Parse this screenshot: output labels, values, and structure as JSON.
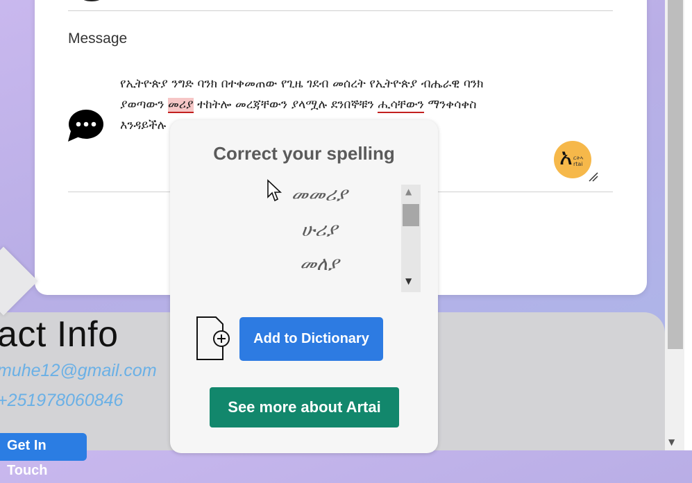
{
  "form": {
    "message_label": "Message",
    "message_lines": [
      {
        "segments": [
          {
            "text": "የኢትዮጵያ ንግድ ባንክ በተቀመጠው የጊዜ ገደብ መሰረት የኢትዮጵያ ብሔራዊ ባንክ",
            "style": "plain"
          }
        ]
      },
      {
        "segments": [
          {
            "text": "ያወጣውን ",
            "style": "plain"
          },
          {
            "text": "መሪያ",
            "style": "misspelled-selected"
          },
          {
            "text": " ተከትሎ መረጃቸውን ያላሟሉ ደንበኞቹን  ",
            "style": "plain"
          },
          {
            "text": "ሒሳቸውን",
            "style": "misspelled"
          },
          {
            "text": " ማንቀሳቀስ",
            "style": "plain"
          }
        ]
      },
      {
        "segments": [
          {
            "text": "እንዳይችሉ",
            "style": "plain"
          }
        ]
      }
    ],
    "artai_logo_glyph": "አ",
    "artai_logo_small": "ርትኣ\nrtai"
  },
  "contact": {
    "title": "act Info",
    "email": "muhe12@gmail.com",
    "phone": "+251978060846",
    "button_label": "Get In Touch"
  },
  "popup": {
    "title": "Correct your spelling",
    "suggestions": [
      "መመሪያ",
      "ሁሪያ",
      "መለያ"
    ],
    "add_dictionary_label": "Add to Dictionary",
    "see_more_label": "See more about Artai"
  },
  "colors": {
    "primary_blue": "#2d7be2",
    "green": "#12876c",
    "error_red": "#c2201f",
    "highlight": "#f6c6c6",
    "logo_orange": "#f6b84a",
    "contact_text": "#6ab0e6"
  },
  "icons": [
    "chat-bubble-icon",
    "artai-logo-icon",
    "resize-handle-icon",
    "add-document-icon",
    "mouse-cursor-icon",
    "scroll-up-icon",
    "scroll-down-icon"
  ]
}
